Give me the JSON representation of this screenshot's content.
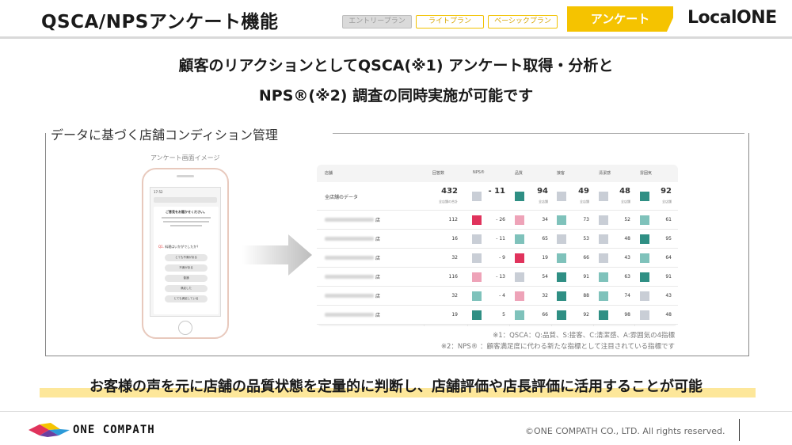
{
  "header": {
    "title": "QSCA/NPSアンケート機能",
    "plans": [
      "エントリープラン",
      "ライトプラン",
      "ベーシックプラン"
    ],
    "active_plan": "アンケート",
    "brand": "LocalONE"
  },
  "headline": {
    "line1": "顧客のリアクションとしてQSCA(※1) アンケート取得・分析と",
    "line2": "NPS®(※2) 調査の同時実施が可能です"
  },
  "section": {
    "label": "データに基づく店舗コンディション管理",
    "phone_caption": "アンケート画面イメージ",
    "phone": {
      "status": "17:52",
      "greeting": "ご意見をお聞かせください。",
      "question_num": "Q1.",
      "question": "料理はいかがでしたか？",
      "options": [
        "とても不満がある",
        "不満がある",
        "普通",
        "満足した",
        "とても満足している"
      ]
    }
  },
  "table": {
    "headers": [
      "店舗",
      "回答数",
      "NPS®",
      "品質",
      "接客",
      "清潔感",
      "雰囲気"
    ],
    "total": {
      "label": "全店舗のデータ",
      "count": "432",
      "count_sub": "全店舗の合計",
      "nps": "- 11",
      "q": "94",
      "q_sub": "全店舗",
      "s": "49",
      "s_sub": "全店舗",
      "c": "48",
      "c_sub": "全店舗",
      "a": "92",
      "a_sub": "全店舗",
      "colors": [
        "#c9ced6",
        "#2f8f84",
        "#c9ced6",
        "#c9ced6",
        "#2f8f84"
      ]
    },
    "rows": [
      {
        "suffix": "店",
        "count": "112",
        "nps": "- 26",
        "q": "34",
        "s": "73",
        "c": "52",
        "a": "61",
        "colors": [
          "#e0335c",
          "#eea3b8",
          "#7fc2bb",
          "#c9ced6",
          "#7fc2bb"
        ]
      },
      {
        "suffix": "店",
        "count": "16",
        "nps": "- 11",
        "q": "65",
        "s": "53",
        "c": "48",
        "a": "95",
        "colors": [
          "#c9ced6",
          "#7fc2bb",
          "#c9ced6",
          "#c9ced6",
          "#2f8f84"
        ]
      },
      {
        "suffix": "店",
        "count": "32",
        "nps": "- 9",
        "q": "19",
        "s": "66",
        "c": "43",
        "a": "64",
        "colors": [
          "#c9ced6",
          "#e0335c",
          "#7fc2bb",
          "#c9ced6",
          "#7fc2bb"
        ]
      },
      {
        "suffix": "店",
        "count": "116",
        "nps": "- 13",
        "q": "54",
        "s": "91",
        "c": "63",
        "a": "91",
        "colors": [
          "#eea3b8",
          "#c9ced6",
          "#2f8f84",
          "#7fc2bb",
          "#2f8f84"
        ]
      },
      {
        "suffix": "店",
        "count": "32",
        "nps": "- 4",
        "q": "32",
        "s": "88",
        "c": "74",
        "a": "43",
        "colors": [
          "#7fc2bb",
          "#eea3b8",
          "#2f8f84",
          "#7fc2bb",
          "#c9ced6"
        ]
      },
      {
        "suffix": "店",
        "count": "19",
        "nps": "5",
        "q": "66",
        "s": "92",
        "c": "98",
        "a": "48",
        "colors": [
          "#2f8f84",
          "#7fc2bb",
          "#2f8f84",
          "#2f8f84",
          "#c9ced6"
        ]
      }
    ]
  },
  "notes": {
    "note1": "※1：QSCA：Q:品質、S:接客、C:清潔感、A:雰囲気の4指標",
    "note2": "※2：NPS® ：顧客満足度に代わる新たな指標として注目されている指標です"
  },
  "tagline": "お客様の声を元に店舗の品質状態を定量的に判断し、店舗評価や店長評価に活用することが可能",
  "footer": {
    "company": "ONE COMPATH",
    "copyright": "©ONE COMPATH CO., LTD. All rights reserved."
  },
  "colors": {
    "accent": "#f5c300",
    "highlight": "#fde79a",
    "dark_teal": "#2f8f84",
    "light_teal": "#7fc2bb",
    "pink": "#eea3b8",
    "red": "#e0335c",
    "gray": "#c9ced6"
  }
}
